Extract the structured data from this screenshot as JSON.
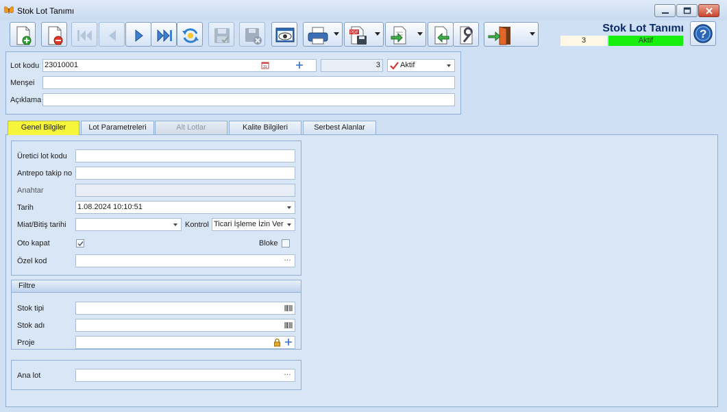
{
  "window": {
    "title": "Stok Lot Tanımı"
  },
  "header": {
    "title": "Stok Lot Tanımı",
    "count": "3",
    "status": "Aktif",
    "status_color": "#19ef0f"
  },
  "form": {
    "lot_kodu_label": "Lot kodu",
    "lot_kodu_value": "23010001",
    "counter_value": "3",
    "status_select": "Aktif",
    "mensei_label": "Menşei",
    "aciklama_label": "Açıklama"
  },
  "tabs": [
    {
      "label": "Genel Bilgiler",
      "state": "active"
    },
    {
      "label": "Lot Parametreleri",
      "state": "normal"
    },
    {
      "label": "Alt Lotlar",
      "state": "disabled"
    },
    {
      "label": "Kalite Bilgileri",
      "state": "normal"
    },
    {
      "label": "Serbest Alanlar",
      "state": "normal"
    }
  ],
  "genel": {
    "ureticiLabel": "Üretici lot kodu",
    "antrepoLabel": "Antrepo takip no",
    "anahtarLabel": "Anahtar",
    "tarihLabel": "Tarih",
    "tarihValue": "1.08.2024 10:10:51",
    "miatLabel": "Miat/Bitiş tarihi",
    "kontrolLabel": "Kontrol",
    "kontrolValue": "Ticari İşleme İzin Ver",
    "otoKapatLabel": "Oto kapat",
    "otoKapatChecked": true,
    "blokeLabel": "Bloke",
    "blokeChecked": false,
    "ozelKodLabel": "Özel kod"
  },
  "filtre": {
    "title": "Filtre",
    "stokTipiLabel": "Stok tipi",
    "stokAdiLabel": "Stok adı",
    "projeLabel": "Proje"
  },
  "anaLot": {
    "label": "Ana lot"
  },
  "icons": {
    "app": "butterfly-icon",
    "toolbar": [
      "new-icon",
      "delete-icon",
      "first-icon",
      "previous-icon",
      "next-icon",
      "last-icon",
      "refresh-icon",
      "save-icon",
      "cancel-save-icon",
      "preview-icon",
      "print-icon",
      "pdf-icon",
      "export-icon",
      "import-icon",
      "tools-icon",
      "exit-icon",
      "help-icon"
    ]
  }
}
